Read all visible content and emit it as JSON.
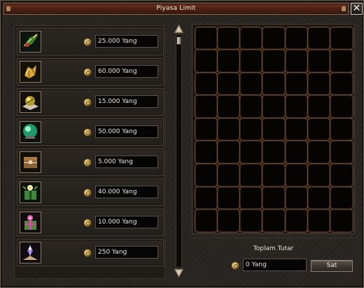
{
  "window": {
    "title": "Piyasa Limit",
    "close_label": "✕"
  },
  "items": [
    {
      "icon": "herb-bundle-icon",
      "price": "25.000 Yang"
    },
    {
      "icon": "gold-crystal-icon",
      "price": "60.000 Yang"
    },
    {
      "icon": "golden-orb-icon",
      "price": "15.000 Yang"
    },
    {
      "icon": "green-orb-icon",
      "price": "50.000 Yang"
    },
    {
      "icon": "treasure-chest-icon",
      "price": "5.000 Yang"
    },
    {
      "icon": "flower-gift-box-icon",
      "price": "40.000 Yang"
    },
    {
      "icon": "pink-gift-box-icon",
      "price": "10.000 Yang"
    },
    {
      "icon": "purple-crystal-stand-icon",
      "price": "250 Yang"
    }
  ],
  "total": {
    "label": "Toplam Tutar",
    "value": "0 Yang",
    "sell_label": "Sat"
  },
  "grid": {
    "columns": 7,
    "rows": 9
  },
  "colors": {
    "title_bar": "#4b1f13",
    "cell_border": "#6b4a2d",
    "panel_bg": "#262320"
  }
}
